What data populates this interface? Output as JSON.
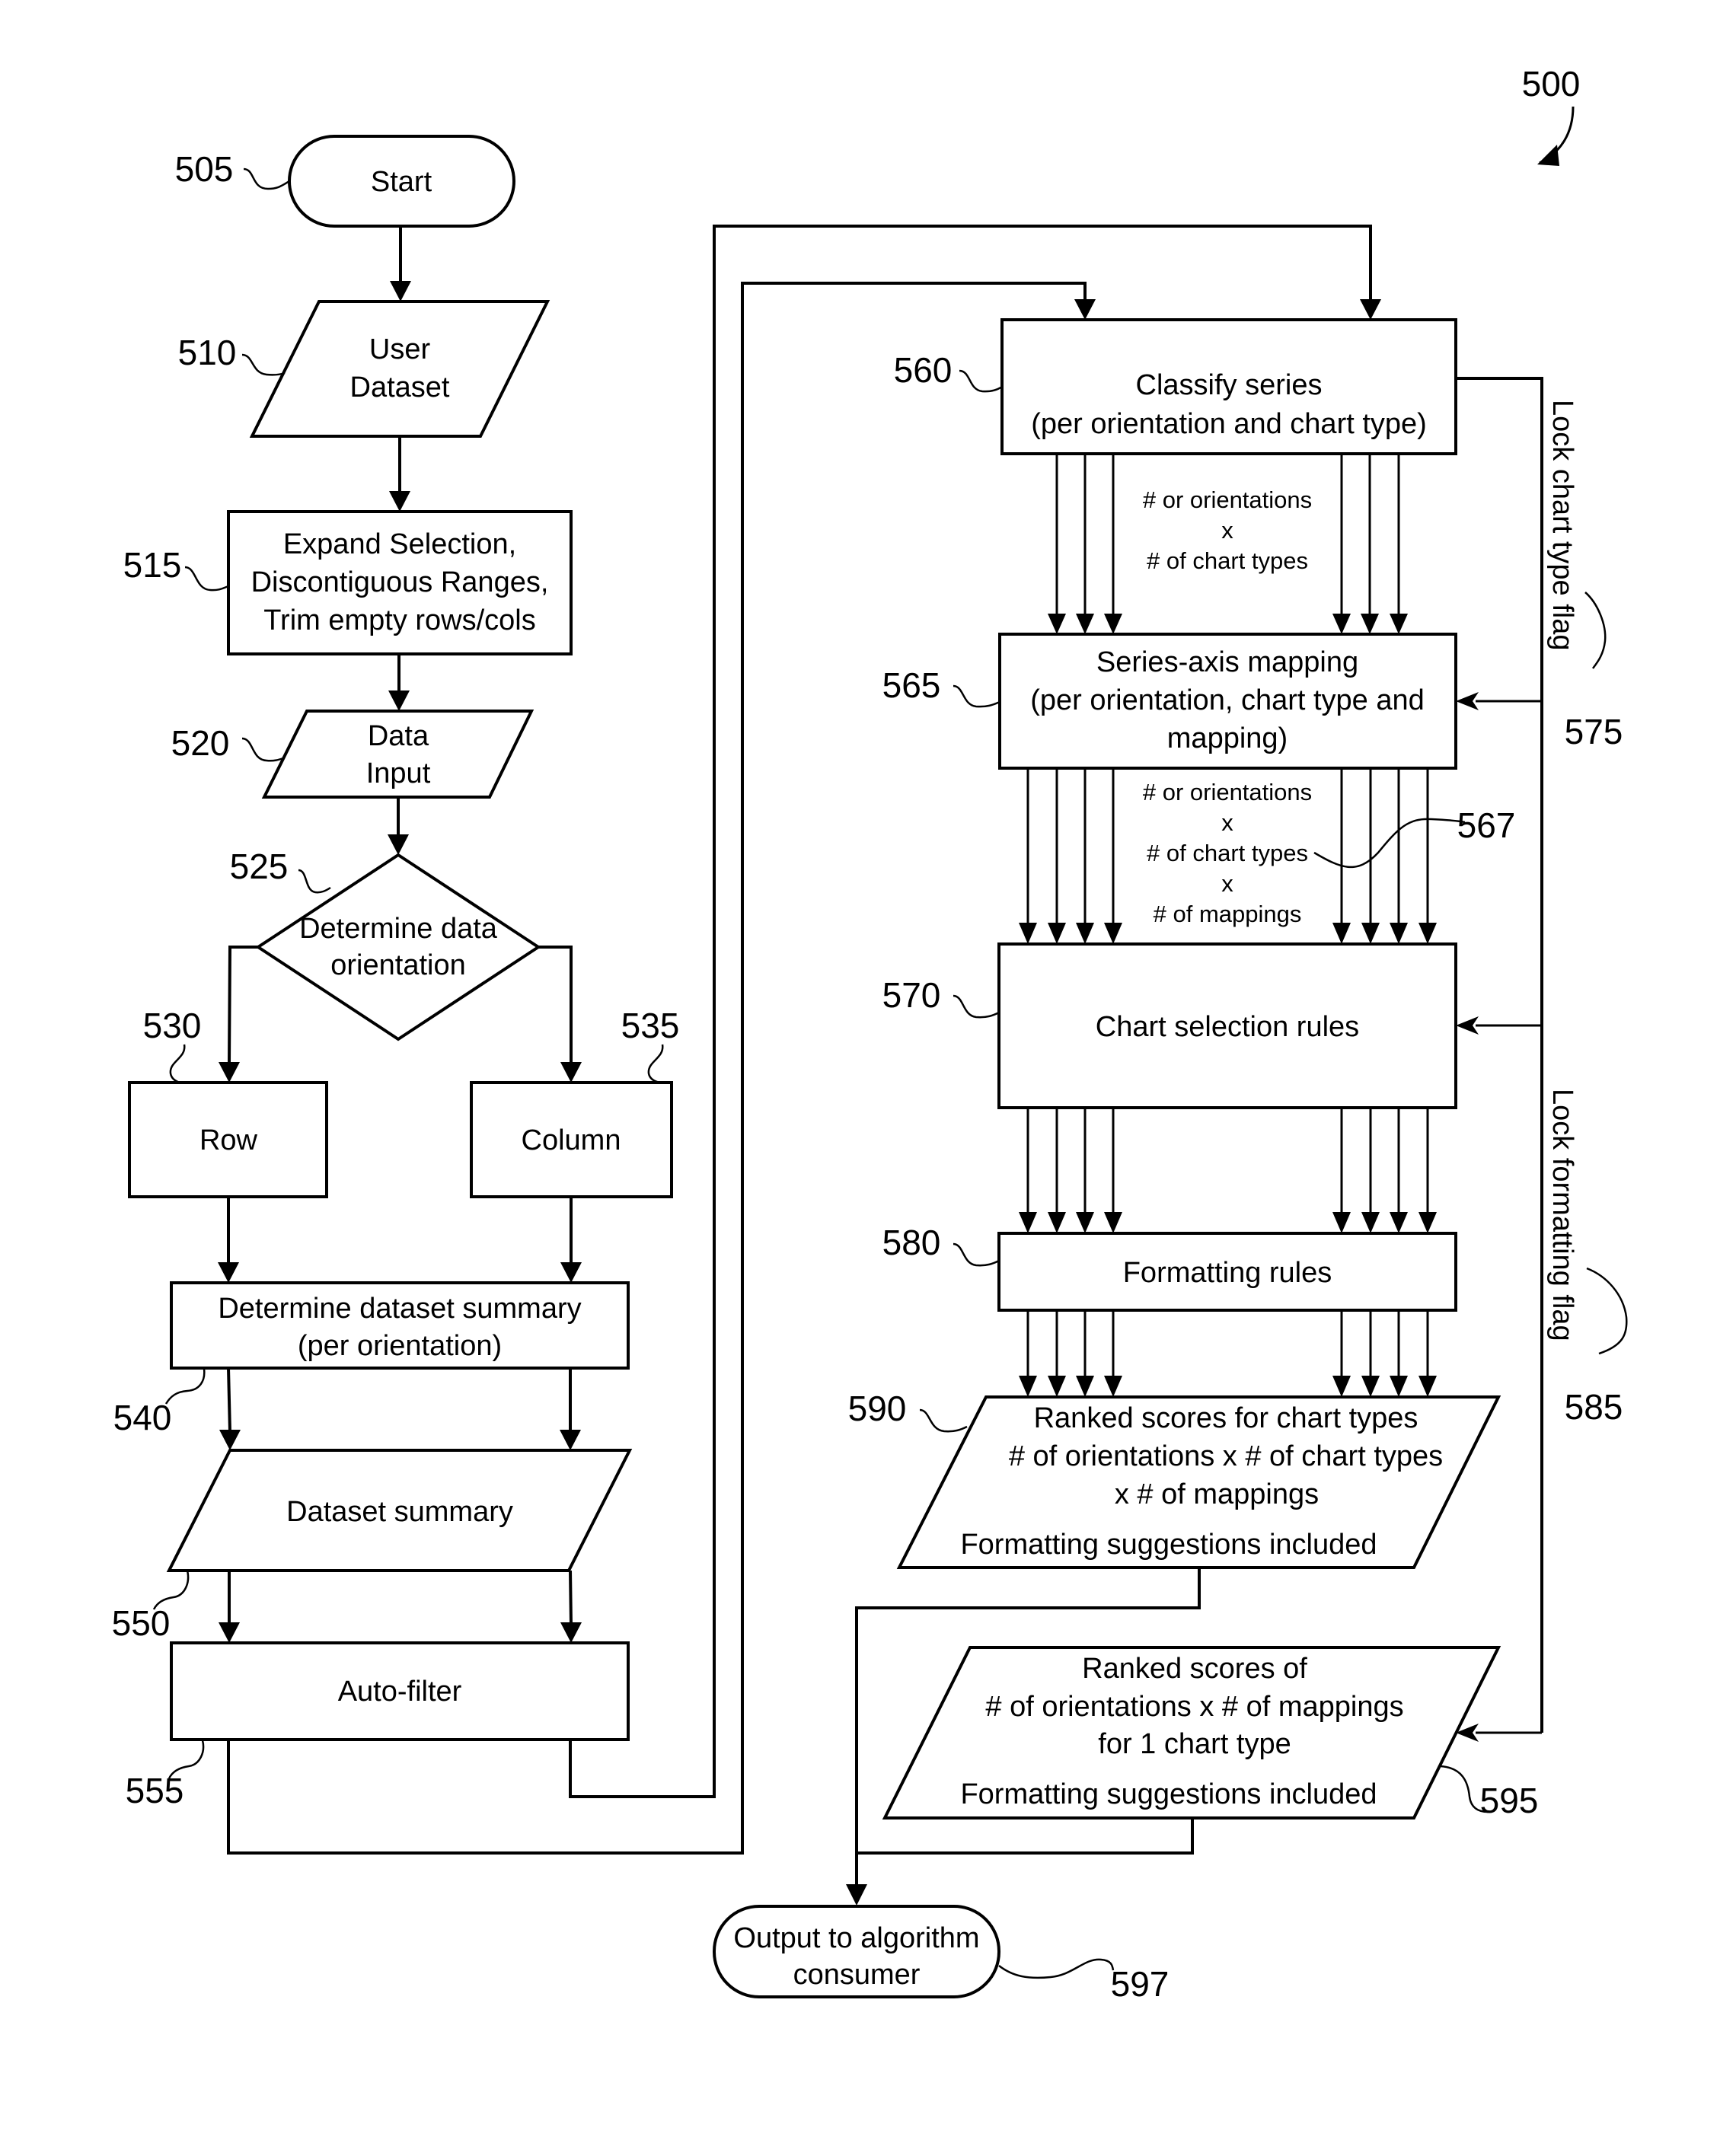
{
  "figure": {
    "number": "500",
    "nodes": {
      "start": {
        "ref": "505",
        "lines": [
          "Start"
        ]
      },
      "user_dataset": {
        "ref": "510",
        "lines": [
          "User",
          "Dataset"
        ]
      },
      "expand_selection": {
        "ref": "515",
        "lines": [
          "Expand Selection,",
          "Discontiguous Ranges,",
          "Trim empty rows/cols"
        ]
      },
      "data_input": {
        "ref": "520",
        "lines": [
          "Data",
          "Input"
        ]
      },
      "determine_orientation": {
        "ref": "525",
        "lines": [
          "Determine data",
          "orientation"
        ]
      },
      "row": {
        "ref": "530",
        "lines": [
          "Row"
        ]
      },
      "column": {
        "ref": "535",
        "lines": [
          "Column"
        ]
      },
      "determine_summary": {
        "ref": "540",
        "lines": [
          "Determine dataset summary",
          "(per orientation)"
        ]
      },
      "dataset_summary": {
        "ref": "550",
        "lines": [
          "Dataset summary"
        ]
      },
      "auto_filter": {
        "ref": "555",
        "lines": [
          "Auto-filter"
        ]
      },
      "classify_series": {
        "ref": "560",
        "lines": [
          "Classify series",
          "(per orientation and chart type)"
        ]
      },
      "series_axis_mapping": {
        "ref": "565",
        "lines": [
          "Series-axis mapping",
          "(per orientation, chart type and",
          "mapping)"
        ]
      },
      "chart_selection_rules": {
        "ref": "570",
        "lines": [
          "Chart selection rules"
        ]
      },
      "formatting_rules": {
        "ref": "580",
        "lines": [
          "Formatting rules"
        ]
      },
      "ranked_scores_all": {
        "ref": "590",
        "lines": [
          "Ranked scores for chart types",
          "# of orientations x # of chart types",
          "x # of mappings",
          "Formatting suggestions included"
        ]
      },
      "ranked_scores_one": {
        "ref": "595",
        "lines": [
          "Ranked scores of",
          "# of orientations x # of mappings",
          "for 1 chart type",
          "Formatting suggestions included"
        ]
      },
      "output": {
        "ref": "597",
        "lines": [
          "Output to algorithm",
          "consumer"
        ]
      }
    },
    "annotations": {
      "flow_560_565": [
        "# or orientations",
        "x",
        "# of chart types"
      ],
      "flow_565_570": {
        "ref": "567",
        "lines": [
          "# or orientations",
          "x",
          "# of chart types",
          "x",
          "# of mappings"
        ]
      },
      "lock_chart_type": {
        "ref": "575",
        "text": "Lock chart type flag"
      },
      "lock_formatting": {
        "ref": "585",
        "text": "Lock formatting flag"
      }
    }
  }
}
